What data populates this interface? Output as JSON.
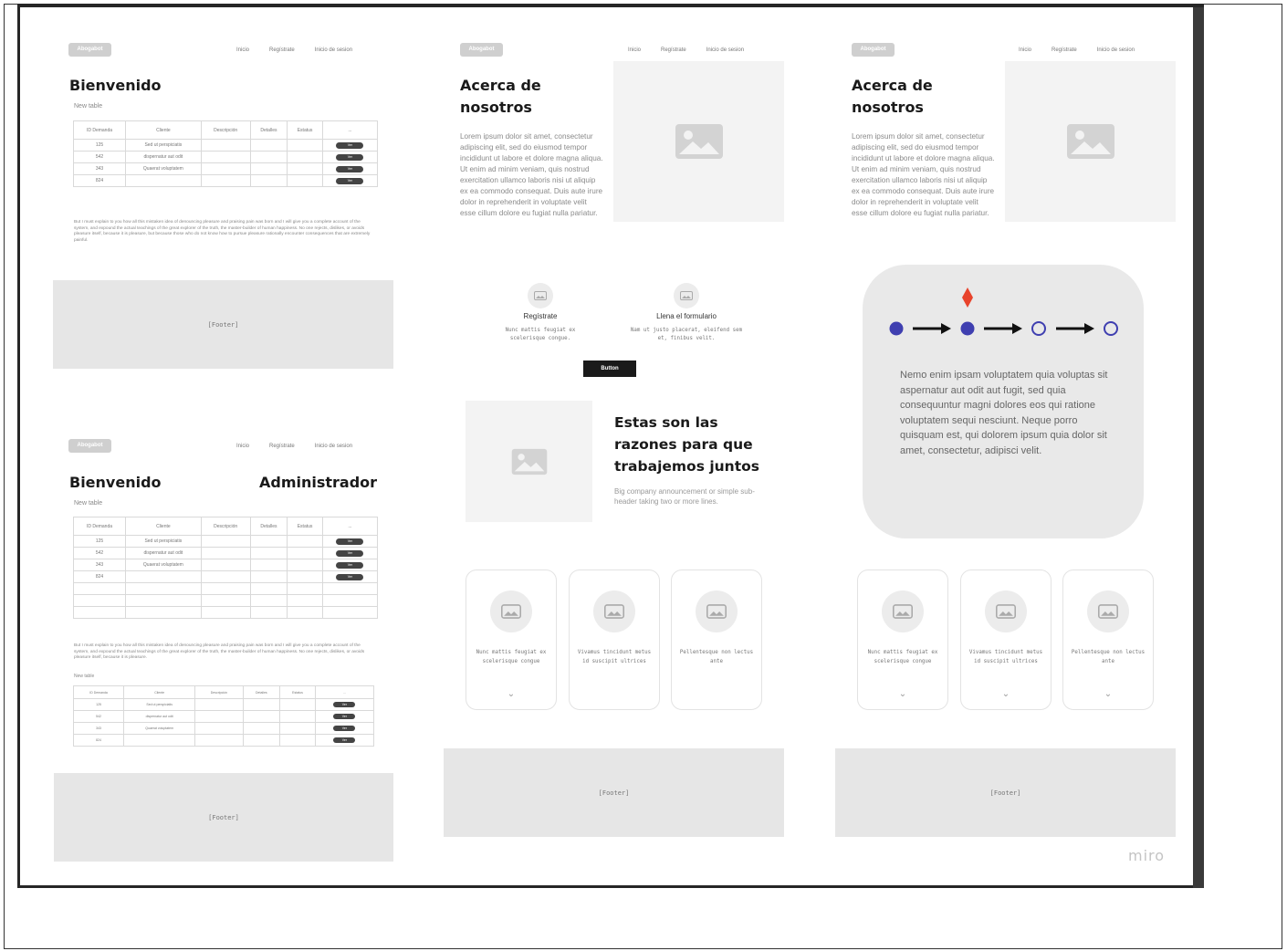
{
  "brand": "Abogabot",
  "nav": [
    "Inicio",
    "Regístrate",
    "Inicio de sesion"
  ],
  "home": {
    "title": "Bienvenido",
    "table_title": "New table",
    "columns": [
      "ID Demanda",
      "Cliente",
      "Descripción",
      "Detalles",
      "Estatus",
      "..."
    ],
    "rows": [
      [
        "125",
        "Sed ut perspiciatis"
      ],
      [
        "542",
        "dispernatur aut odit"
      ],
      [
        "343",
        "Quaerat voluptatem"
      ],
      [
        "824",
        ""
      ]
    ],
    "pill": "Ver",
    "text": "But I must explain to you how all this mistaken idea of denouncing pleasure and praising pain was born and I will give you a complete account of the system, and expound the actual teachings of the great explorer of the truth, the master-builder of human happiness. No one rejects, dislikes, or avoids pleasure itself, because it is pleasure, but because those who do not know how to pursue pleasure rationally encounter consequences that are extremely painful."
  },
  "admin": {
    "title": "Bienvenido",
    "role": "Administrador",
    "table_title": "New table",
    "text": "But I must explain to you how all this mistaken idea of denouncing pleasure and praising pain was born and I will give you a complete account of the system, and expound the actual teachings of the great explorer of the truth, the master-builder of human happiness. No one rejects, dislikes, or avoids pleasure itself, because it is pleasure.",
    "table2_title": "New table"
  },
  "about": {
    "title": "Acerca de nosotros",
    "text": "Lorem ipsum dolor sit amet, consectetur adipiscing elit, sed do eiusmod tempor incididunt ut labore et dolore magna aliqua. Ut enim ad minim veniam, quis nostrud exercitation ullamco laboris nisi ut aliquip ex ea commodo consequat. Duis aute irure dolor in reprehenderit in voluptate velit esse cillum dolore eu fugiat nulla pariatur."
  },
  "steps": [
    {
      "title": "Regístrate",
      "text": "Nunc mattis feugiat ex scelerisque congue."
    },
    {
      "title": "Llena el formulario",
      "text": "Nam ut justo placerat, eleifend sem et, finibus velit."
    }
  ],
  "button": "Button",
  "reasons": {
    "title": "Estas son las razones para que trabajemos juntos",
    "sub": "Big company announcement or simple sub-header taking two or more lines."
  },
  "cards": [
    "Nunc mattis feugiat ex scelerisque congue",
    "Vivamus tincidunt metus id suscipit ultrices",
    "Pellentesque non lectus ante"
  ],
  "progress": {
    "text": "Nemo enim ipsam voluptatem quia voluptas sit aspernatur aut odit aut fugit, sed quia consequuntur magni dolores eos qui ratione voluptatem sequi nesciunt. Neque porro quisquam est, qui dolorem ipsum quia dolor sit amet, consectetur, adipisci velit.",
    "steps_total": 4,
    "steps_done": 2,
    "colors": {
      "done": "#3f3fb0",
      "marker": "#e8432b"
    }
  },
  "footer": "[Footer]",
  "watermark": "miro"
}
